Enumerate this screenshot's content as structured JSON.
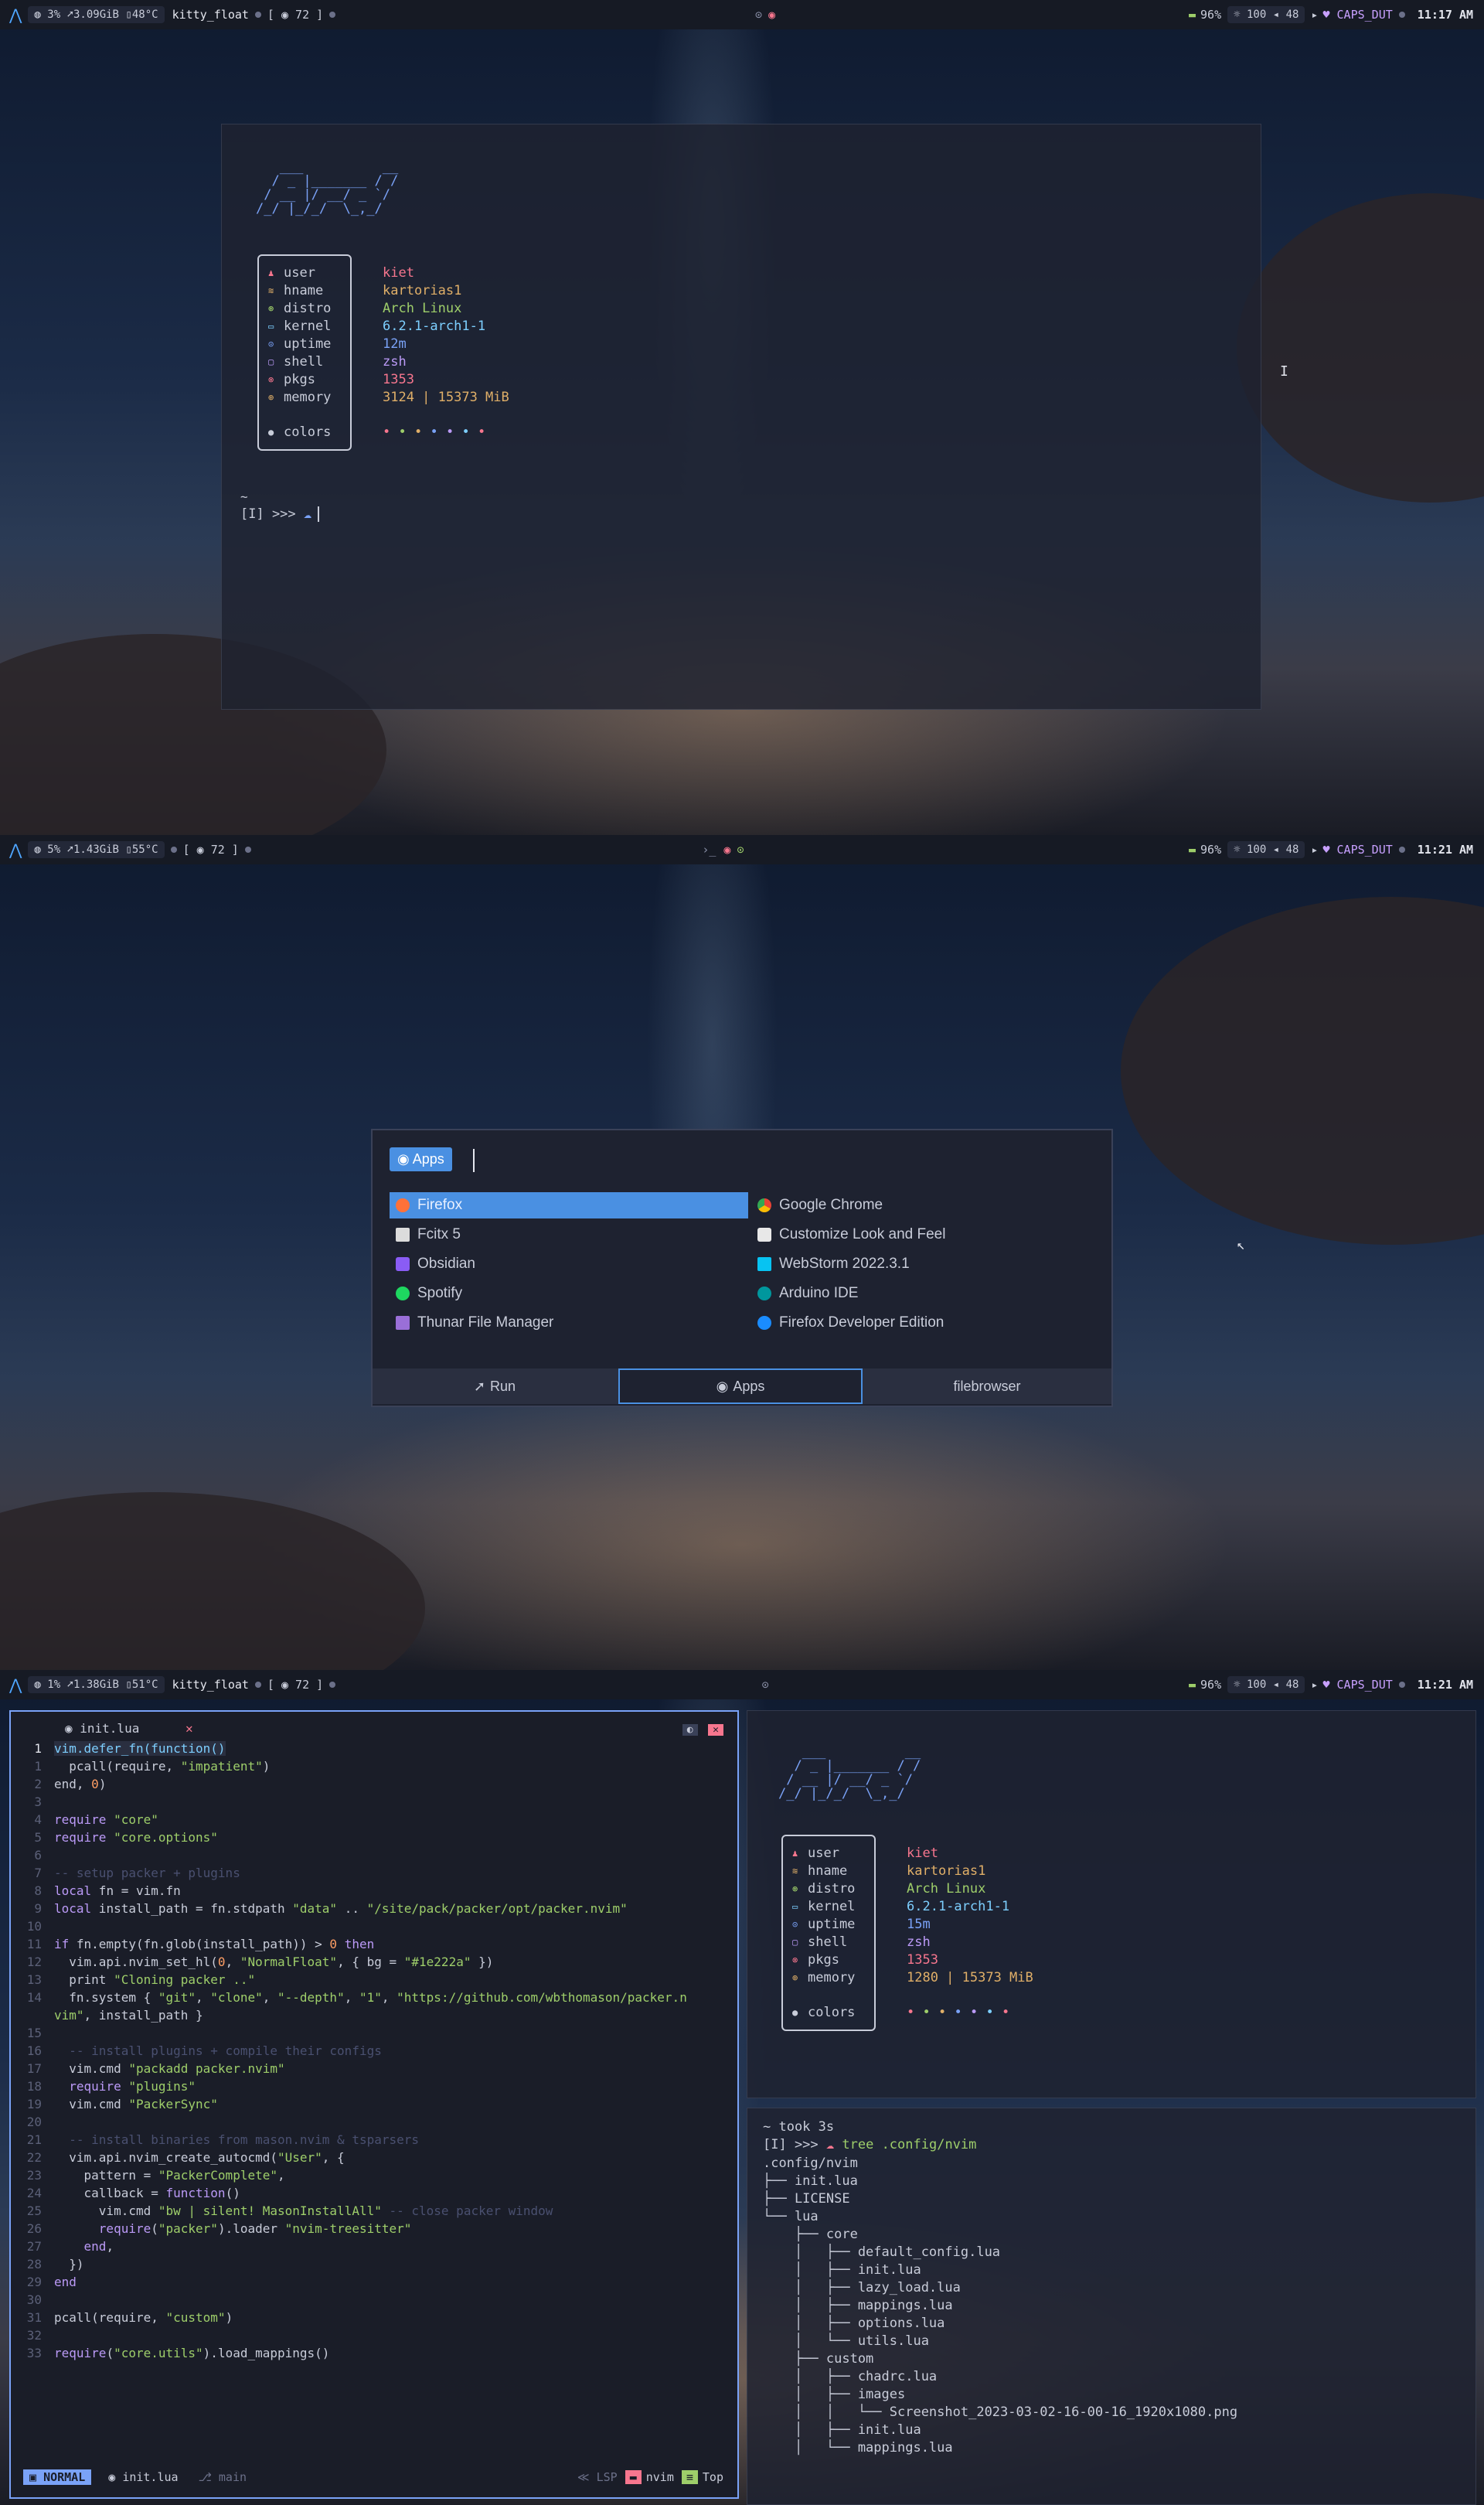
{
  "screen1": {
    "bar": {
      "cpu": "3%",
      "net": "3.09GiB",
      "temp": "48°C",
      "window_title": "kitty_float",
      "workspace": "72",
      "battery": "96%",
      "brightness": "100",
      "volume": "48",
      "keyboard": "CAPS_DUT",
      "time": "11:17 AM"
    },
    "terminal": {
      "ascii_art": "   ___          __\n  / _ |_______ / /\n / __ |/ __/ _ `/\n/_/ |_/_/  \\_,_/",
      "info": [
        {
          "key": "user",
          "value": "kiet",
          "color": "#f7768e"
        },
        {
          "key": "hname",
          "value": "kartorias1",
          "color": "#e0af68"
        },
        {
          "key": "distro",
          "value": "Arch Linux",
          "color": "#9ece6a"
        },
        {
          "key": "kernel",
          "value": "6.2.1-arch1-1",
          "color": "#7dcfff"
        },
        {
          "key": "uptime",
          "value": "12m",
          "color": "#7aa2f7"
        },
        {
          "key": "shell",
          "value": "zsh",
          "color": "#bb9af7"
        },
        {
          "key": "pkgs",
          "value": "1353",
          "color": "#f7768e"
        },
        {
          "key": "memory",
          "value": "3124 | 15373 MiB",
          "color": "#e0af68"
        }
      ],
      "colors_label": "colors",
      "prompt_dir": "~",
      "prompt": "[I] >>>"
    }
  },
  "screen2": {
    "bar": {
      "cpu": "5%",
      "net": "1.43GiB",
      "temp": "55°C",
      "workspace": "72",
      "battery": "96%",
      "brightness": "100",
      "volume": "48",
      "keyboard": "CAPS_DUT",
      "time": "11:21 AM"
    },
    "rofi": {
      "mode_label": "Apps",
      "query": "",
      "apps_left": [
        "Firefox",
        "Fcitx 5",
        "Obsidian",
        "Spotify",
        "Thunar File Manager"
      ],
      "apps_right": [
        "Google Chrome",
        "Customize Look and Feel",
        "WebStorm 2022.3.1",
        "Arduino IDE",
        "Firefox Developer Edition"
      ],
      "tabs": [
        "Run",
        "Apps",
        "filebrowser"
      ]
    }
  },
  "screen3": {
    "bar": {
      "cpu": "1%",
      "net": "1.38GiB",
      "temp": "51°C",
      "window_title": "kitty_float",
      "workspace": "72",
      "battery": "96%",
      "brightness": "100",
      "volume": "48",
      "keyboard": "CAPS_DUT",
      "time": "11:21 AM"
    },
    "editor": {
      "tab_name": "init.lua",
      "statusline": {
        "mode": "NORMAL",
        "file": "init.lua",
        "branch": "main",
        "lsp": "LSP",
        "prog": "nvim",
        "pos": "Top"
      }
    },
    "fetch": {
      "info": [
        {
          "key": "user",
          "value": "kiet",
          "color": "#f7768e"
        },
        {
          "key": "hname",
          "value": "kartorias1",
          "color": "#e0af68"
        },
        {
          "key": "distro",
          "value": "Arch Linux",
          "color": "#9ece6a"
        },
        {
          "key": "kernel",
          "value": "6.2.1-arch1-1",
          "color": "#7dcfff"
        },
        {
          "key": "uptime",
          "value": "15m",
          "color": "#7aa2f7"
        },
        {
          "key": "shell",
          "value": "zsh",
          "color": "#bb9af7"
        },
        {
          "key": "pkgs",
          "value": "1353",
          "color": "#f7768e"
        },
        {
          "key": "memory",
          "value": "1280 | 15373 MiB",
          "color": "#e0af68"
        }
      ],
      "colors_label": "colors"
    },
    "tree_term": {
      "took": "~ took 3s",
      "prompt": "[I] >>> ",
      "command": "tree .config/nvim",
      "lines": [
        ".config/nvim",
        "├── init.lua",
        "├── LICENSE",
        "└── lua",
        "    ├── core",
        "    │   ├── default_config.lua",
        "    │   ├── init.lua",
        "    │   ├── lazy_load.lua",
        "    │   ├── mappings.lua",
        "    │   ├── options.lua",
        "    │   └── utils.lua",
        "    ├── custom",
        "    │   ├── chadrc.lua",
        "    │   ├── images",
        "    │   │   └── Screenshot_2023-03-02-16-00-16_1920x1080.png",
        "    │   ├── init.lua",
        "    │   └── mappings.lua"
      ]
    }
  }
}
